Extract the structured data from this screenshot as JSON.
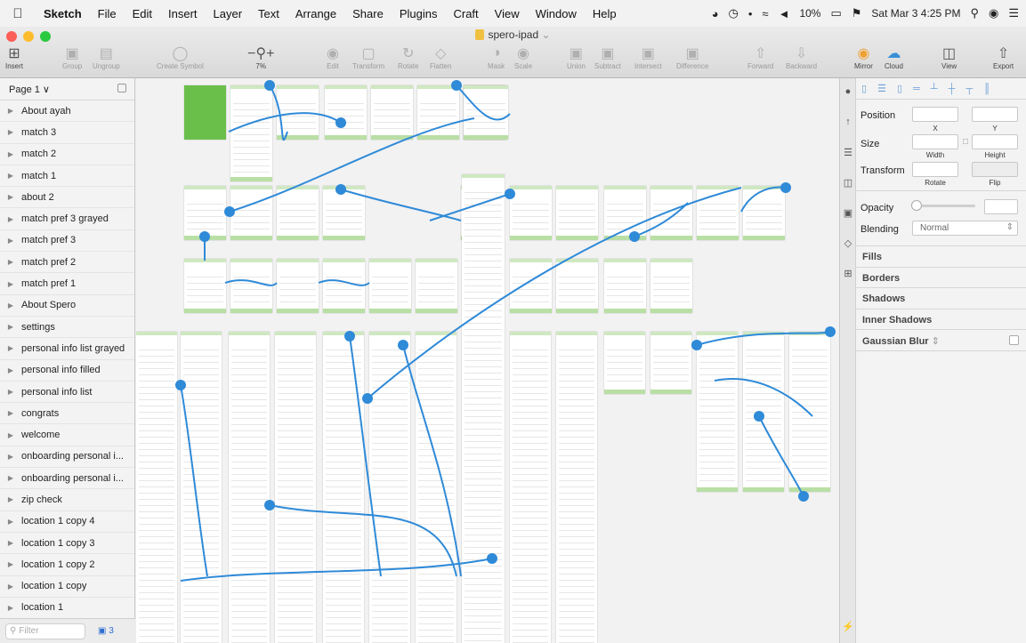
{
  "menubar": {
    "apple": "",
    "app_name": "Sketch",
    "items": [
      "File",
      "Edit",
      "Insert",
      "Layer",
      "Text",
      "Arrange",
      "Share",
      "Plugins",
      "Craft",
      "View",
      "Window",
      "Help"
    ],
    "battery": "10%",
    "datetime": "Sat Mar 3  4:25 PM"
  },
  "window": {
    "title": "spero-ipad"
  },
  "toolbar": {
    "insert": "Insert",
    "group": "Group",
    "ungroup": "Ungroup",
    "create_symbol": "Create Symbol",
    "zoom": "7%",
    "edit": "Edit",
    "transform": "Transform",
    "rotate": "Rotate",
    "flatten": "Flatten",
    "mask": "Mask",
    "scale": "Scale",
    "union": "Union",
    "subtract": "Subtract",
    "intersect": "Intersect",
    "difference": "Difference",
    "forward": "Forward",
    "backward": "Backward",
    "mirror": "Mirror",
    "cloud": "Cloud",
    "view": "View",
    "export": "Export"
  },
  "sidebar": {
    "page": "Page 1 ∨",
    "layers": [
      "About ayah",
      "match 3",
      "match 2",
      "match 1",
      "about 2",
      "match pref 3 grayed",
      "match pref 3",
      "match pref 2",
      "match pref 1",
      "About Spero",
      "settings",
      "personal info list grayed",
      "personal info filled",
      "personal info list",
      "congrats",
      "welcome",
      "onboarding personal i...",
      "onboarding personal i...",
      "zip check",
      "location 1 copy 4",
      "location 1 copy 3",
      "location 1 copy 2",
      "location 1 copy",
      "location 1"
    ],
    "filter_placeholder": "Filter",
    "filter_count": "3"
  },
  "inspector": {
    "position_label": "Position",
    "x_label": "X",
    "y_label": "Y",
    "size_label": "Size",
    "width_label": "Width",
    "height_label": "Height",
    "transform_label": "Transform",
    "rotate_label": "Rotate",
    "flip_label": "Flip",
    "opacity_label": "Opacity",
    "blending_label": "Blending",
    "blending_value": "Normal",
    "sections": [
      "Fills",
      "Borders",
      "Shadows",
      "Inner Shadows",
      "Gaussian Blur"
    ]
  },
  "colors": {
    "accent_blue": "#3a8fd6",
    "brand_green": "#6abf4b",
    "wire_blue": "#2f8ad8"
  }
}
